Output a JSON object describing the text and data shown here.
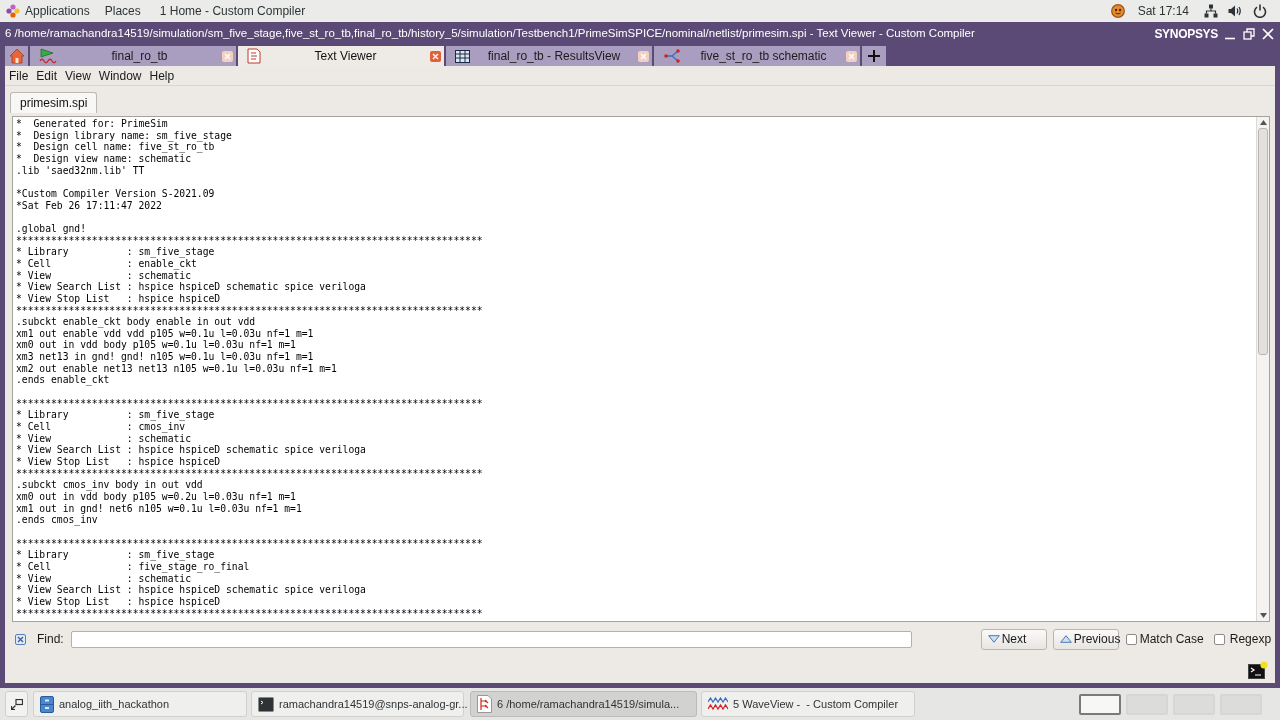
{
  "top_bar": {
    "menus": [
      "Applications",
      "Places"
    ],
    "active_window": "1 Home - Custom Compiler",
    "clock": "Sat 17:14"
  },
  "window": {
    "title": "6 /home/ramachandra14519/simulation/sm_five_stage,five_st_ro_tb,final_ro_tb/history_5/simulation/Testbench1/PrimeSimSPICE/nominal/netlist/primesim.spi - Text Viewer - Custom Compiler",
    "logo": "SYNOPSYS"
  },
  "tabs": [
    {
      "kind": "home",
      "selected": false
    },
    {
      "kind": "waveform",
      "label": "final_ro_tb",
      "selected": false
    },
    {
      "kind": "text",
      "label": "Text Viewer",
      "selected": true
    },
    {
      "kind": "results",
      "label": "final_ro_tb - ResultsView",
      "selected": false
    },
    {
      "kind": "schematic",
      "label": "five_st_ro_tb schematic",
      "selected": false
    }
  ],
  "menu_bar": [
    "File",
    "Edit",
    "View",
    "Window",
    "Help"
  ],
  "document_tabs": [
    {
      "label": "primesim.spi",
      "selected": true
    }
  ],
  "text_viewer": {
    "blocks": [
      [
        "*  Generated for: PrimeSim",
        "*  Design library name: sm_five_stage",
        "*  Design cell name: five_st_ro_tb",
        "*  Design view name: schematic",
        ".lib 'saed32nm.lib' TT"
      ],
      [
        "*Custom Compiler Version S-2021.09",
        "*Sat Feb 26 17:11:47 2022"
      ],
      [
        ".global gnd!",
        "********************************************************************************",
        "* Library          : sm_five_stage",
        "* Cell             : enable_ckt",
        "* View             : schematic",
        "* View Search List : hspice hspiceD schematic spice veriloga",
        "* View Stop List   : hspice hspiceD",
        "********************************************************************************",
        ".subckt enable_ckt body enable in out vdd",
        "xm1 out enable vdd vdd p105 w=0.1u l=0.03u nf=1 m=1",
        "xm0 out in vdd body p105 w=0.1u l=0.03u nf=1 m=1",
        "xm3 net13 in gnd! gnd! n105 w=0.1u l=0.03u nf=1 m=1",
        "xm2 out enable net13 net13 n105 w=0.1u l=0.03u nf=1 m=1",
        ".ends enable_ckt"
      ],
      [
        "********************************************************************************",
        "* Library          : sm_five_stage",
        "* Cell             : cmos_inv",
        "* View             : schematic",
        "* View Search List : hspice hspiceD schematic spice veriloga",
        "* View Stop List   : hspice hspiceD",
        "********************************************************************************",
        ".subckt cmos_inv body in out vdd",
        "xm0 out in vdd body p105 w=0.2u l=0.03u nf=1 m=1",
        "xm1 out in gnd! net6 n105 w=0.1u l=0.03u nf=1 m=1",
        ".ends cmos_inv"
      ],
      [
        "********************************************************************************",
        "* Library          : sm_five_stage",
        "* Cell             : five_stage_ro_final",
        "* View             : schematic",
        "* View Search List : hspice hspiceD schematic spice veriloga",
        "* View Stop List   : hspice hspiceD",
        "********************************************************************************"
      ]
    ]
  },
  "find_bar": {
    "label": "Find:",
    "buttons": [
      {
        "kind": "next",
        "label": "Next"
      },
      {
        "kind": "previous",
        "label": "Previous"
      }
    ],
    "options": [
      {
        "label": "Match Case",
        "checked": false
      },
      {
        "label": "Regexp",
        "checked": false
      }
    ]
  },
  "taskbar": {
    "items": [
      {
        "kind": "files",
        "label": "analog_iith_hackathon",
        "selected": false
      },
      {
        "kind": "terminal",
        "label": "ramachandra14519@snps-analog-gr...",
        "selected": false
      },
      {
        "kind": "schematic",
        "label": "6 /home/ramachandra14519/simula...",
        "selected": true
      },
      {
        "kind": "waveview",
        "label": "5 WaveView -  - Custom Compiler",
        "selected": false
      }
    ],
    "workspaces": [
      {
        "selected": true
      },
      {
        "selected": false
      },
      {
        "selected": false
      },
      {
        "selected": false
      }
    ]
  }
}
